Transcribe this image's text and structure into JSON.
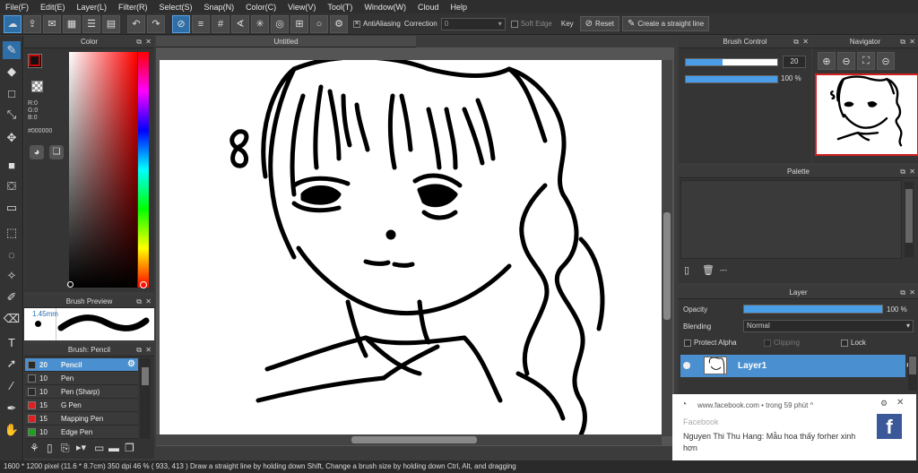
{
  "menu": [
    "File(F)",
    "Edit(E)",
    "Layer(L)",
    "Filter(R)",
    "Select(S)",
    "Snap(N)",
    "Color(C)",
    "View(V)",
    "Tool(T)",
    "Window(W)",
    "Cloud",
    "Help"
  ],
  "toolbar": {
    "antialiasing": "AntiAliasing",
    "correction_label": "Correction",
    "correction_value": "0",
    "soft_edge": "Soft Edge",
    "key": "Key",
    "reset": "Reset",
    "straight_line": "Create a straight line"
  },
  "color_panel": {
    "title": "Color",
    "r": "R:0",
    "g": "G:0",
    "b": "B:0",
    "hex": "#000000",
    "foreground": "#cc0000"
  },
  "brush_preview": {
    "title": "Brush Preview",
    "size": "1.45mm"
  },
  "brush_list": {
    "title": "Brush: Pencil",
    "items": [
      {
        "size": "20",
        "name": "Pencil",
        "color": "#2a2a2a"
      },
      {
        "size": "10",
        "name": "Pen",
        "color": "#2a2a2a"
      },
      {
        "size": "10",
        "name": "Pen (Sharp)",
        "color": "#2a2a2a"
      },
      {
        "size": "15",
        "name": "G Pen",
        "color": "#e02020"
      },
      {
        "size": "15",
        "name": "Mapping Pen",
        "color": "#e02020"
      },
      {
        "size": "10",
        "name": "Edge Pen",
        "color": "#20a020"
      }
    ]
  },
  "canvas": {
    "tab": "Untitled"
  },
  "brush_control": {
    "title": "Brush Control",
    "size_value": "20",
    "size_fraction": 0.4,
    "opacity_value": "100 %",
    "opacity_fraction": 1.0
  },
  "navigator": {
    "title": "Navigator"
  },
  "palette": {
    "title": "Palette",
    "ellipsis": "---"
  },
  "layer": {
    "title": "Layer",
    "opacity_label": "Opacity",
    "opacity_value": "100 %",
    "blending_label": "Blending",
    "blending_value": "Normal",
    "protect_alpha": "Protect Alpha",
    "clipping": "Clipping",
    "lock": "Lock",
    "layer1": "Layer1"
  },
  "status": {
    "text": "1600 * 1200 pixel  (11.6 * 8.7cm)  350 dpi  46 %  ( 933, 413 )  Draw a straight line by holding down Shift, Change a brush size by holding down Ctrl, Alt, and dragging"
  },
  "notification": {
    "source": "www.facebook.com • trong 59 phút ^",
    "title": "Facebook",
    "message": "Nguyen Thi Thu Hang: Mẫu hoa thấy forher xinh hơn"
  },
  "colors": {
    "accent": "#4a90d0",
    "panel": "#353535"
  }
}
